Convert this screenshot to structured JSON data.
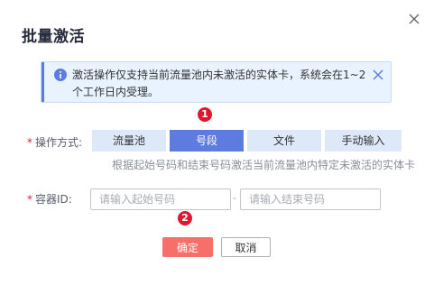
{
  "dialog": {
    "title": "批量激活",
    "close_icon": "close-icon"
  },
  "notice": {
    "icon": "info-icon",
    "text": "激活操作仅支持当前流量池内未激活的实体卡，系统会在1~2个工作日内受理。",
    "close_icon": "close-icon"
  },
  "markers": [
    "1",
    "2"
  ],
  "form": {
    "mode_label": "操作方式:",
    "mode_options": [
      "流量池",
      "号段",
      "文件",
      "手动输入"
    ],
    "mode_selected": "号段",
    "mode_hint": "根据起始号码和结束号码激活当前流量池内特定未激活的实体卡",
    "id_label": "容器ID:",
    "required_mark": "*",
    "start_placeholder": "请输入起始号码",
    "end_placeholder": "请输入结束号码",
    "range_separator": "-"
  },
  "buttons": {
    "ok": "确定",
    "cancel": "取消"
  },
  "colors": {
    "primary": "#5e7ce0",
    "danger_button": "#f66f6a",
    "marker": "#e0182f",
    "notice_bg": "#e8f3ff"
  }
}
